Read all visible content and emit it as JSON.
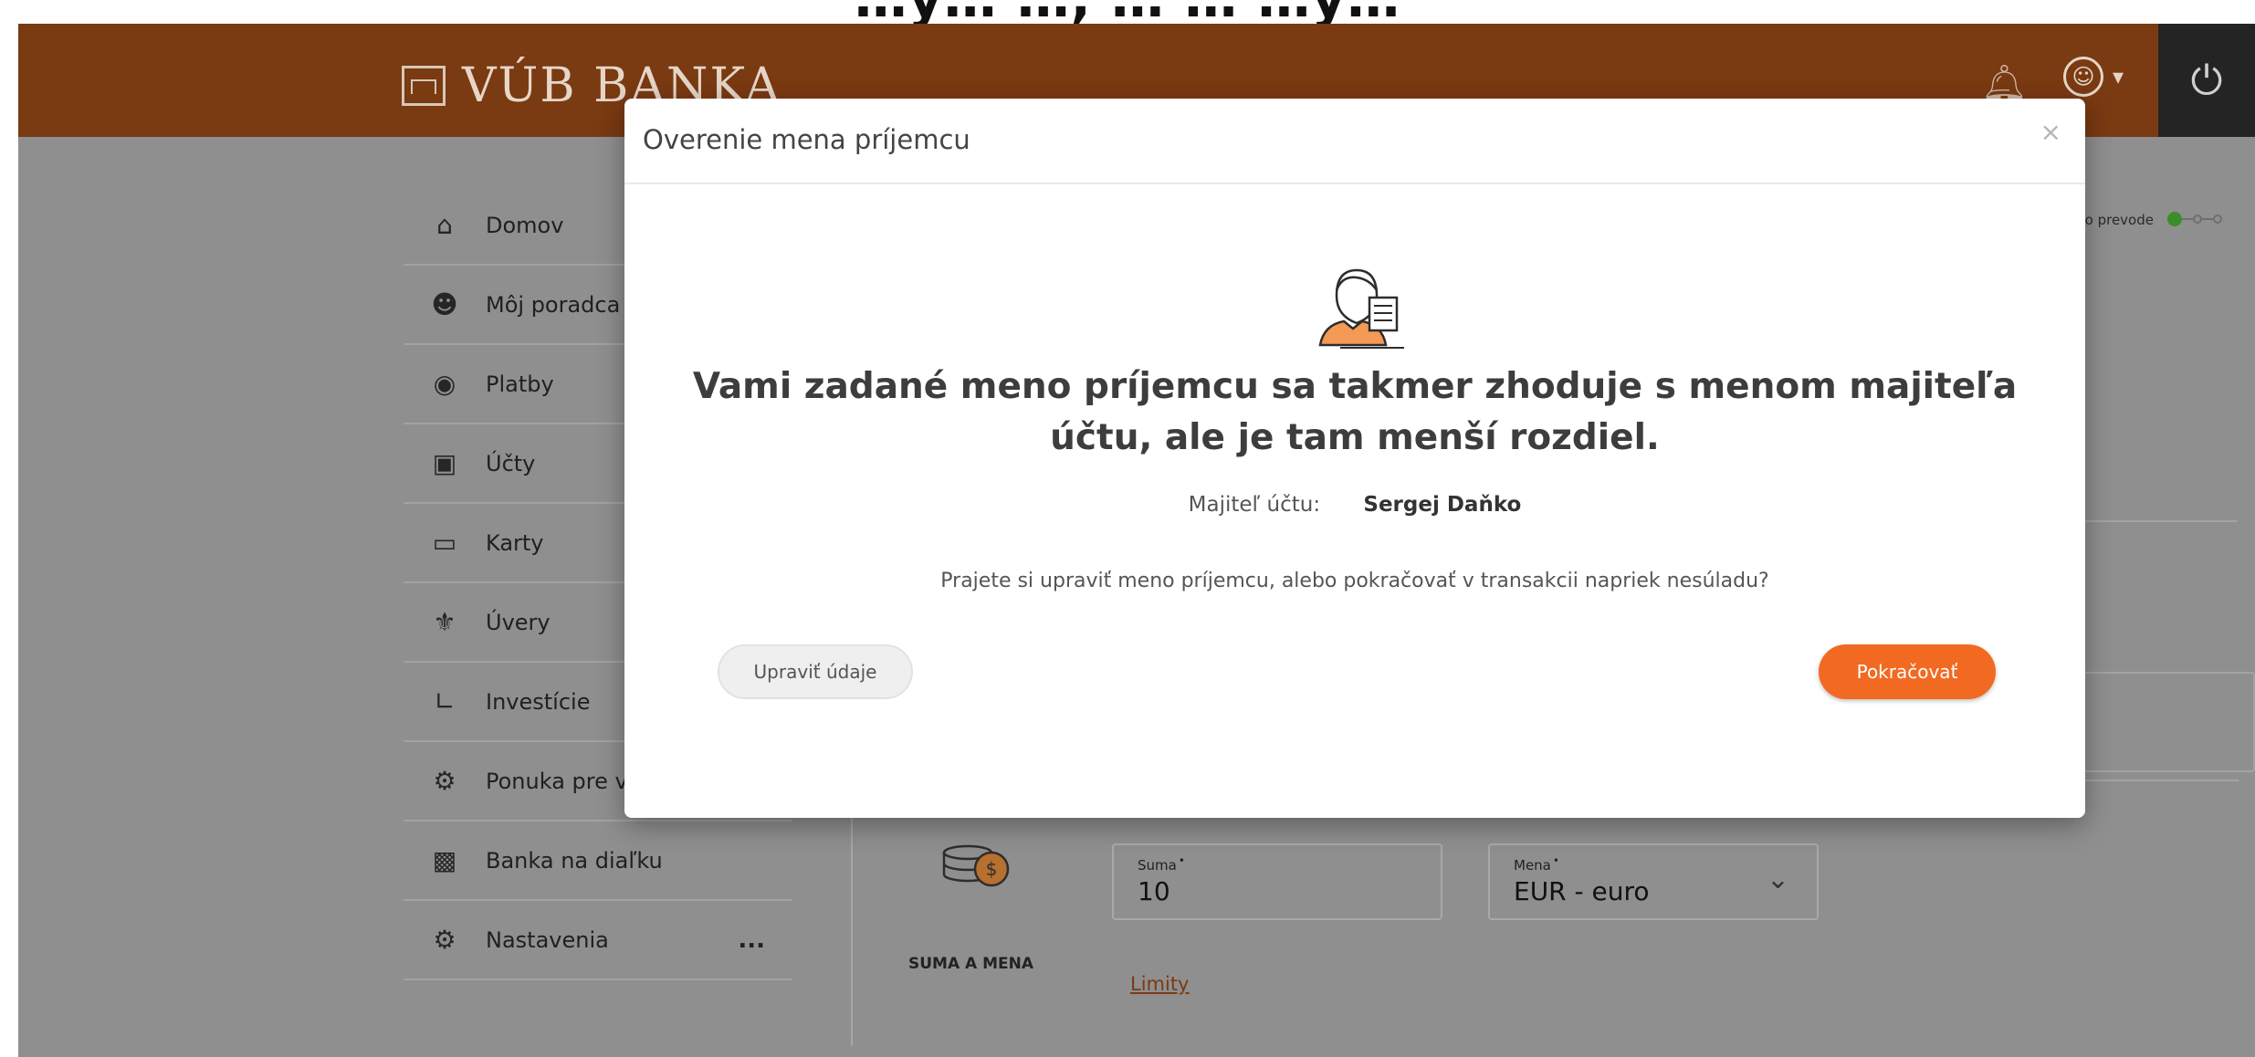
{
  "caption": "…ý… …, … … …ý…",
  "header": {
    "bank_name": "VÚB BANKA"
  },
  "sidebar": {
    "items": [
      {
        "label": "Domov",
        "icon": "home-icon"
      },
      {
        "label": "Môj poradca",
        "icon": "advisor-icon"
      },
      {
        "label": "Platby",
        "icon": "payments-icon"
      },
      {
        "label": "Účty",
        "icon": "wallet-icon"
      },
      {
        "label": "Karty",
        "icon": "card-icon"
      },
      {
        "label": "Úvery",
        "icon": "loan-icon"
      },
      {
        "label": "Investície",
        "icon": "chart-icon"
      },
      {
        "label": "Ponuka pre vás",
        "icon": "offer-icon"
      },
      {
        "label": "Banka na diaľku",
        "icon": "phone-icon"
      },
      {
        "label": "Nastavenia",
        "icon": "gear-icon",
        "more": "..."
      }
    ]
  },
  "progress": {
    "label": "v o prevode"
  },
  "amount": {
    "section_label": "SUMA A MENA",
    "amount_label": "Suma",
    "amount_value": "10",
    "currency_label": "Mena",
    "currency_value": "EUR - euro",
    "limits_link": "Limity"
  },
  "modal": {
    "title": "Overenie mena príjemcu",
    "close": "×",
    "headline": "Vami zadané meno príjemcu sa takmer zhoduje s menom majiteľa účtu, ale je tam menší rozdiel.",
    "owner_label": "Majiteľ účtu:",
    "owner_name": "Sergej Daňko",
    "question": "Prajete si upraviť meno príjemcu, alebo pokračovať v transakcii napriek nesúladu?",
    "edit_button": "Upraviť údaje",
    "continue_button": "Pokračovať"
  },
  "colors": {
    "header": "#7a3a12",
    "accent": "#f26a21",
    "overlay": "#8f8f8f"
  }
}
